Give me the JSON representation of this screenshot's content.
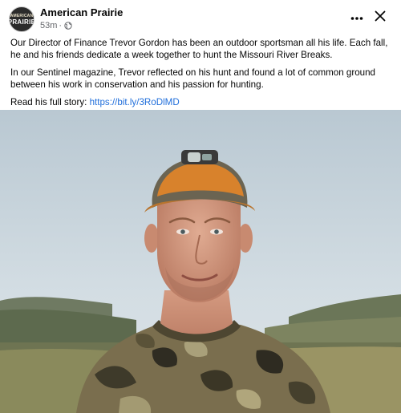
{
  "post": {
    "page_name": "American Prairie",
    "avatar_line1": "AMERICAN",
    "avatar_line2": "PRAIRIE",
    "timestamp": "53m",
    "separator": "·",
    "audience_icon": "globe-icon",
    "paragraph1": "Our Director of Finance Trevor Gordon has been an outdoor sportsman all his life. Each fall, he and his friends dedicate a week together to hunt the Missouri River Breaks.",
    "paragraph2": "In our Sentinel magazine, Trevor reflected on his hunt and found a lot of common ground between his work in conservation and his passion for hunting.",
    "paragraph3_prefix": "Read his full story: ",
    "link_text": "https://bit.ly/3RoDlMD",
    "image_alt": "Man wearing an orange cap with headlamp and camouflage shirt, outdoors in prairie hills",
    "more_icon": "more-dots-icon",
    "close_icon": "close-icon"
  },
  "colors": {
    "link": "#216fdb",
    "secondary_text": "#65676b",
    "primary_text": "#050505"
  }
}
